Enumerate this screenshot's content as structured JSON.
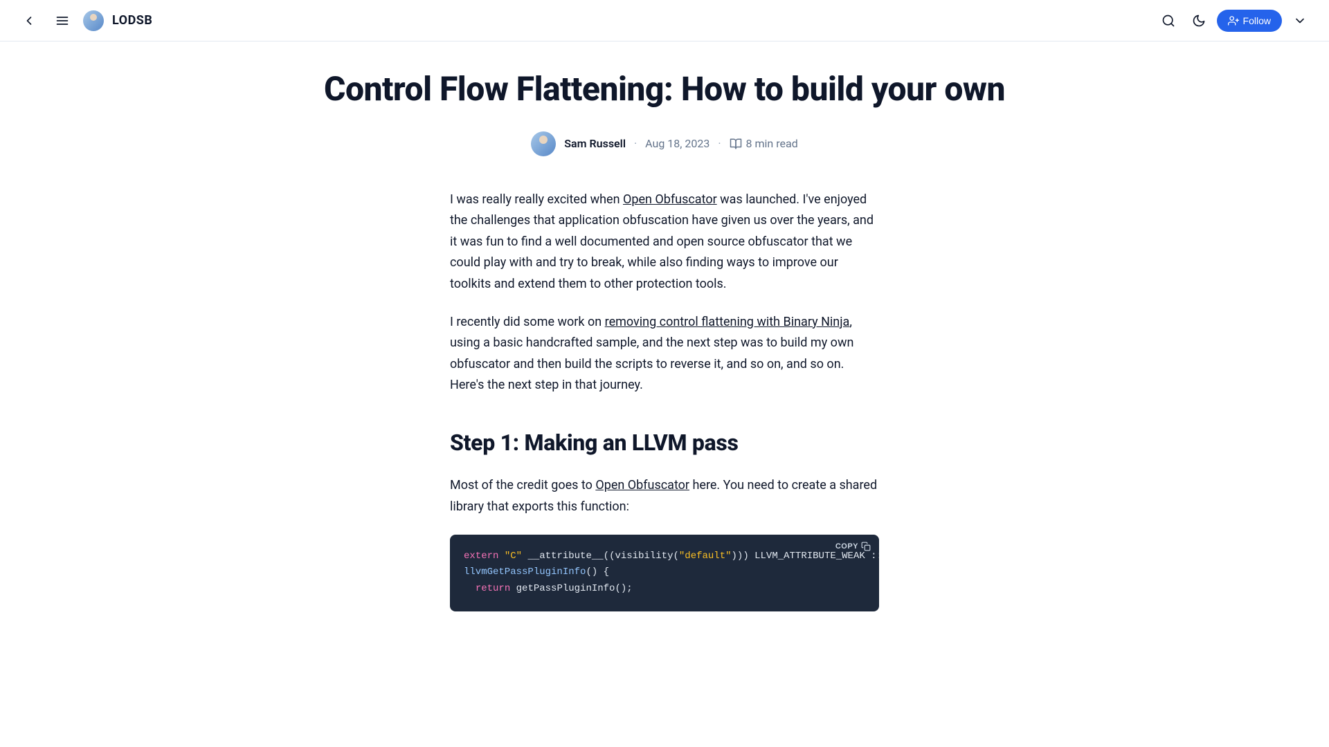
{
  "header": {
    "brand": "LODSB",
    "follow_label": "Follow"
  },
  "article": {
    "title": "Control Flow Flattening: How to build your own",
    "author": "Sam Russell",
    "date": "Aug 18, 2023",
    "read_time": "8 min read"
  },
  "body": {
    "p1_a": "I was really really excited when ",
    "p1_link": "Open Obfuscator",
    "p1_b": " was launched. I've enjoyed the challenges that application obfuscation have given us over the years, and it was fun to find a well documented and open source obfuscator that we could play with and try to break, while also finding ways to improve our toolkits and extend them to other protection tools.",
    "p2_a": "I recently did some work on ",
    "p2_link": "removing control flattening with Binary Ninja",
    "p2_b": ", using a basic handcrafted sample, and the next step was to build my own obfuscator and then build the scripts to reverse it, and so on, and so on. Here's the next step in that journey.",
    "h2_step1": "Step 1: Making an LLVM pass",
    "p3_a": "Most of the credit goes to ",
    "p3_link": "Open Obfuscator",
    "p3_b": " here. You need to create a shared library that exports this function:"
  },
  "code": {
    "copy_label": "COPY",
    "line1_kw": "extern",
    "line1_str": "\"C\"",
    "line1_rest": " __attribute__((visibility(",
    "line1_str2": "\"default\"",
    "line1_rest2": "))) LLVM_ATTRIBUTE_WEAK ::l",
    "line2_func": "llvmGetPassPluginInfo",
    "line2_rest": "() {",
    "line3_indent": "  ",
    "line3_kw": "return",
    "line3_rest": " getPassPluginInfo();"
  }
}
